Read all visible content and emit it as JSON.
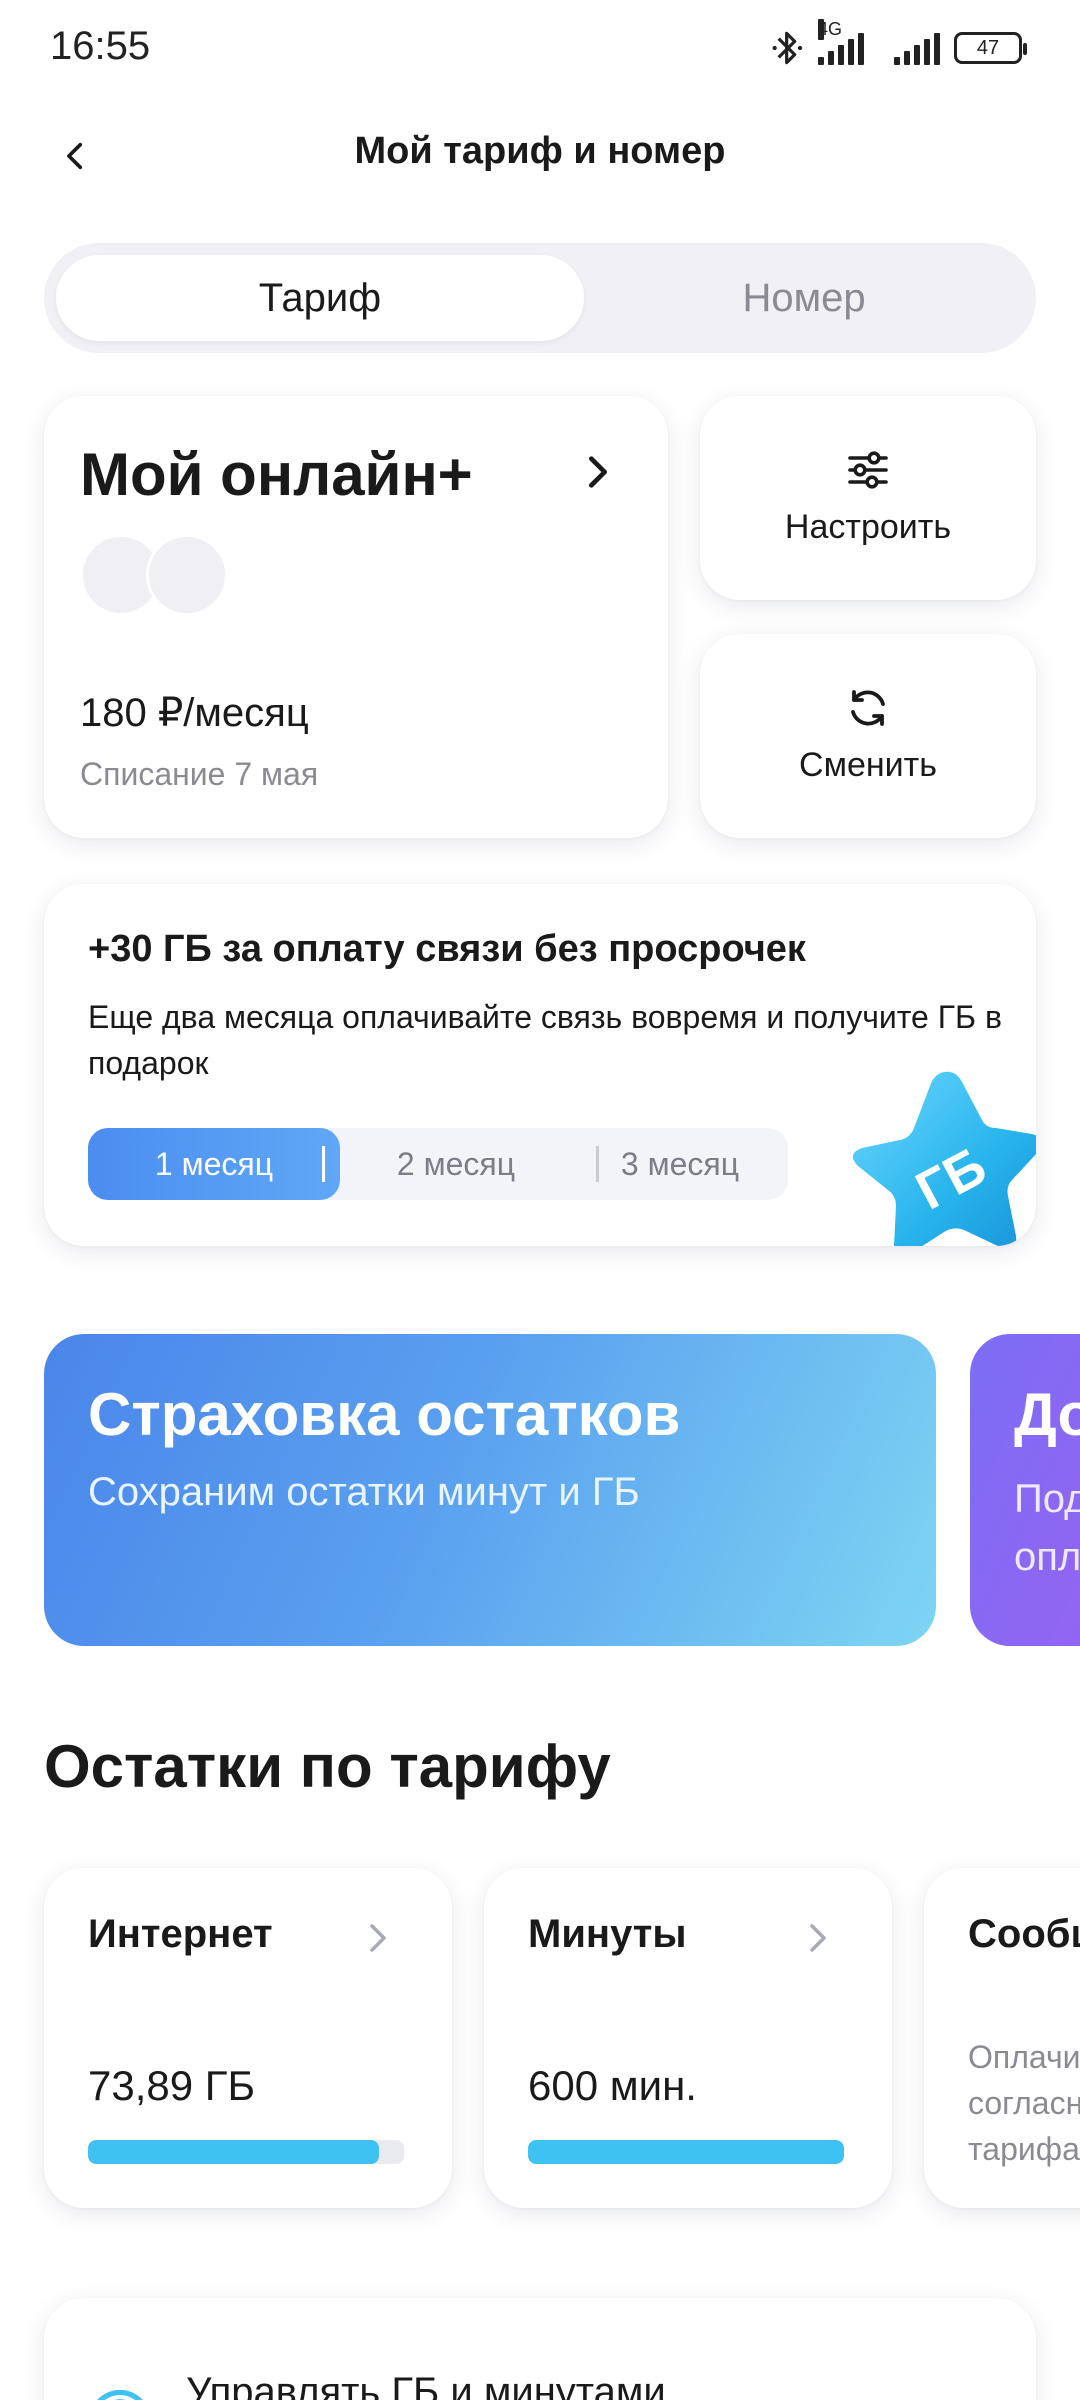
{
  "status_bar": {
    "time": "16:55",
    "network": "4G",
    "battery": "47",
    "icons": [
      "bluetooth-icon",
      "signal-icon",
      "signal-icon",
      "battery-icon"
    ]
  },
  "header": {
    "title": "Мой тариф и номер",
    "back_icon": "chevron-left-icon"
  },
  "segmented": {
    "tabs": [
      {
        "label": "Тариф",
        "active": true
      },
      {
        "label": "Номер",
        "active": false
      }
    ]
  },
  "tariff": {
    "name": "Мой онлайн+",
    "price": "180 ₽/месяц",
    "charge": "Списание 7 мая"
  },
  "actions": {
    "configure": {
      "label": "Настроить",
      "icon": "sliders-icon"
    },
    "change": {
      "label": "Сменить",
      "icon": "refresh-icon"
    }
  },
  "promo": {
    "title": "+30 ГБ за оплату связи без просрочек",
    "description": "Еще два месяца оплачивайте связь вовремя и получите ГБ в подарок",
    "months": [
      "1 месяц",
      "2 месяц",
      "3 месяц"
    ],
    "active_month": 0,
    "badge": "ГБ"
  },
  "banners": [
    {
      "title": "Страховка остатков",
      "subtitle": "Сохраним остатки минут и ГБ"
    },
    {
      "title": "До",
      "subtitle": "Под\nопл"
    }
  ],
  "remainders": {
    "title": "Остатки по тарифу",
    "internet": {
      "title": "Интернет",
      "value": "73,89 ГБ",
      "fill": 0.92
    },
    "minutes": {
      "title": "Минуты",
      "value": "600 мин.",
      "fill": 1.0
    },
    "messages": {
      "title": "Сообщ",
      "note": "Оплачи\nсогласн\nтарифа"
    }
  },
  "manage": {
    "label": "Управлять ГБ и минутами"
  },
  "colors": {
    "accent": "#4b8df0",
    "progress": "#3ec2f2",
    "insurance_banner": "#4a86ea",
    "next_banner": "#7c6df5"
  }
}
